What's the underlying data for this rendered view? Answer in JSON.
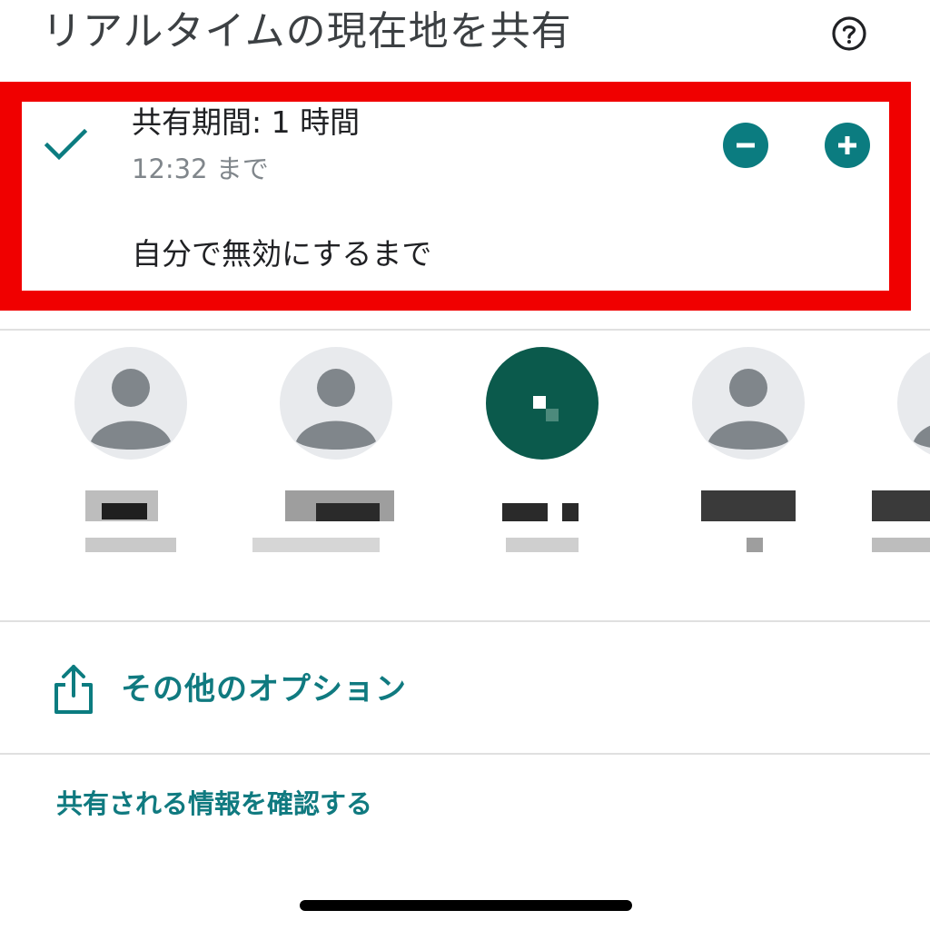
{
  "header": {
    "title": "リアルタイムの現在地を共有",
    "help_icon": "help-circle-icon"
  },
  "duration": {
    "label": "共有期間: 1 時間",
    "until": "12:32 まで",
    "selected_icon": "check-icon",
    "decrease_icon": "minus-circle-icon",
    "increase_icon": "plus-circle-icon",
    "until_off_label": "自分で無効にするまで"
  },
  "contacts": [
    {
      "avatar": "person-placeholder",
      "name": "",
      "detail": ""
    },
    {
      "avatar": "person-placeholder",
      "name": "",
      "detail": ""
    },
    {
      "avatar": "photo",
      "name": "",
      "detail": ""
    },
    {
      "avatar": "person-placeholder",
      "name": "",
      "detail": ""
    },
    {
      "avatar": "person-placeholder",
      "name": "",
      "detail": ""
    }
  ],
  "options": {
    "more_options_label": "その他のオプション",
    "more_options_icon": "share-icon",
    "confirm_info_label": "共有される情報を確認する"
  },
  "colors": {
    "accent": "#0b7c80",
    "highlight": "#f00000",
    "text_primary": "#202124",
    "text_secondary": "#80868b"
  }
}
